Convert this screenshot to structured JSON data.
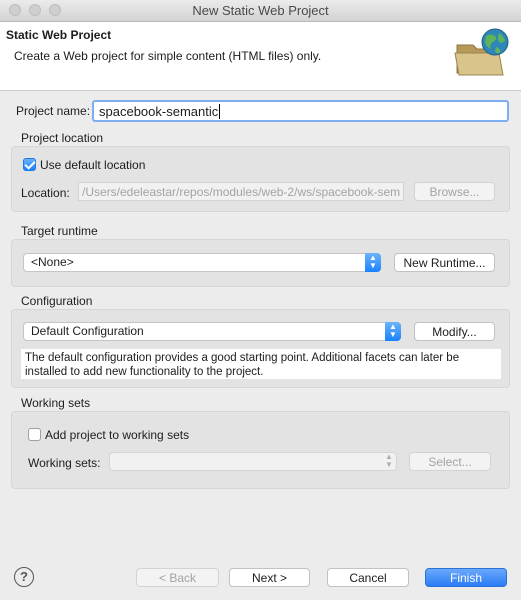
{
  "window": {
    "title": "New Static Web Project"
  },
  "header": {
    "title": "Static Web Project",
    "description": "Create a Web project for simple content (HTML files) only."
  },
  "project_name": {
    "label": "Project name:",
    "value": "spacebook-semantic"
  },
  "project_location": {
    "group_label": "Project location",
    "use_default_label": "Use default location",
    "use_default_checked": true,
    "location_label": "Location:",
    "location_value": "/Users/edeleastar/repos/modules/web-2/ws/spacebook-sem",
    "browse_label": "Browse..."
  },
  "target_runtime": {
    "group_label": "Target runtime",
    "selected": "<None>",
    "new_runtime_label": "New Runtime..."
  },
  "configuration": {
    "group_label": "Configuration",
    "selected": "Default Configuration",
    "modify_label": "Modify...",
    "description": "The default configuration provides a good starting point. Additional facets can later be installed to add new functionality to the project."
  },
  "working_sets": {
    "group_label": "Working sets",
    "add_label": "Add project to working sets",
    "add_checked": false,
    "sets_label": "Working sets:",
    "sets_value": "",
    "select_label": "Select..."
  },
  "footer": {
    "help_icon": "question-icon",
    "back_label": "< Back",
    "next_label": "Next >",
    "cancel_label": "Cancel",
    "finish_label": "Finish"
  },
  "colors": {
    "accent": "#1a82fb",
    "finish_button": "#3d8cf9"
  }
}
